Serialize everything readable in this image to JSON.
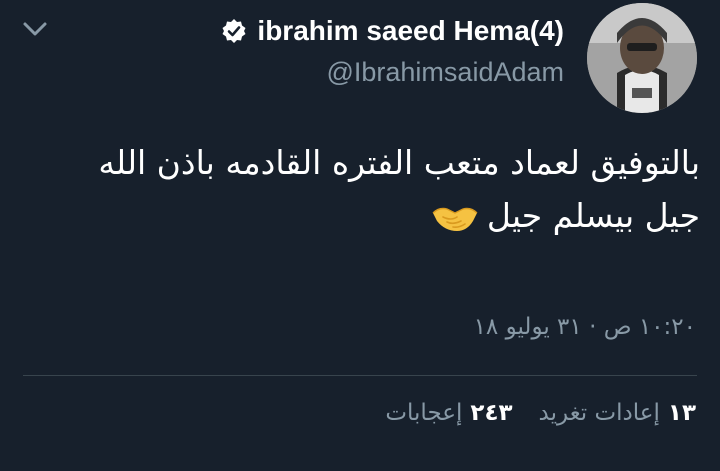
{
  "colors": {
    "background": "#17202c",
    "primary_text": "#ffffff",
    "secondary_text": "#8899a6",
    "divider": "#38444d",
    "verified_badge": "#ffffff",
    "emoji": "#f5c242"
  },
  "tweet": {
    "menu_icon": "chevron-down-icon",
    "author": {
      "display_name": "ibrahim saeed Hema(4)",
      "handle": "@IbrahimsaidAdam",
      "verified_icon": "verified-badge-icon",
      "avatar_icon": "avatar"
    },
    "body": {
      "line1": "بالتوفيق لعماد متعب الفتره القادمه باذن الله",
      "line2": "جيل بيسلم جيل",
      "emoji": "handshake-emoji-icon"
    },
    "timestamp": "١٠:٢٠ ص · ٣١ يوليو ١٨",
    "stats": {
      "retweets_count": "١٣",
      "retweets_label": "إعادات تغريد",
      "likes_count": "٢٤٣",
      "likes_label": "إعجابات"
    }
  }
}
